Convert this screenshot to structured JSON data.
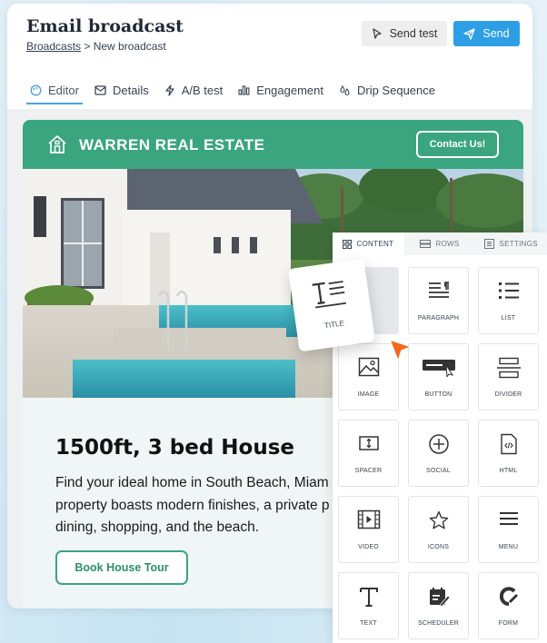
{
  "header": {
    "title": "Email broadcast",
    "breadcrumb_link": "Broadcasts",
    "breadcrumb_sep": " > ",
    "breadcrumb_current": "New broadcast",
    "send_test_label": "Send test",
    "send_label": "Send"
  },
  "tabs": [
    {
      "label": "Editor",
      "icon": "palette-icon",
      "active": true
    },
    {
      "label": "Details",
      "icon": "envelope-icon"
    },
    {
      "label": "A/B test",
      "icon": "lightning-icon"
    },
    {
      "label": "Engagement",
      "icon": "bar-chart-icon"
    },
    {
      "label": "Drip Sequence",
      "icon": "drip-icon"
    }
  ],
  "email": {
    "brand": "WARREN REAL ESTATE",
    "contact_label": "Contact Us!",
    "headline": "1500ft, 3 bed House",
    "description": "Find your ideal home in South Beach, Miam\nproperty boasts modern finishes, a private p\ndining, shopping, and the beach.",
    "cta_label": "Book House Tour",
    "accent_color": "#3aa57f"
  },
  "panel": {
    "tabs": [
      {
        "label": "CONTENT",
        "icon": "grid-icon",
        "active": true
      },
      {
        "label": "ROWS",
        "icon": "rows-icon"
      },
      {
        "label": "SETTINGS",
        "icon": "settings-panel-icon"
      }
    ],
    "dragged_label": "TITLE",
    "blocks": [
      {
        "label": "",
        "icon": "placeholder"
      },
      {
        "label": "PARAGRAPH",
        "icon": "paragraph-icon"
      },
      {
        "label": "LIST",
        "icon": "list-icon"
      },
      {
        "label": "IMAGE",
        "icon": "image-icon"
      },
      {
        "label": "BUTTON",
        "icon": "button-icon"
      },
      {
        "label": "DIVIDER",
        "icon": "divider-icon"
      },
      {
        "label": "SPACER",
        "icon": "spacer-icon"
      },
      {
        "label": "SOCIAL",
        "icon": "social-icon"
      },
      {
        "label": "HTML",
        "icon": "html-icon"
      },
      {
        "label": "VIDEO",
        "icon": "video-icon"
      },
      {
        "label": "ICONS",
        "icon": "star-icon"
      },
      {
        "label": "MENU",
        "icon": "menu-icon"
      },
      {
        "label": "TEXT",
        "icon": "text-icon"
      },
      {
        "label": "SCHEDULER",
        "icon": "scheduler-icon"
      },
      {
        "label": "FORM",
        "icon": "form-icon"
      }
    ]
  },
  "colors": {
    "send_button": "#2e9fe6",
    "brand_green": "#3aa57f",
    "cursor": "#f26a1b"
  }
}
